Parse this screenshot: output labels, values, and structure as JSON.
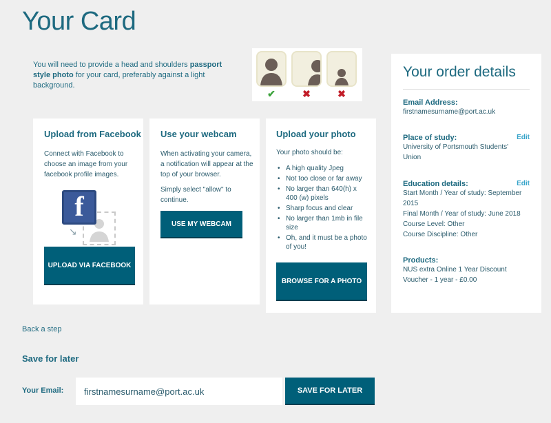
{
  "page": {
    "title": "Your Card"
  },
  "intro": {
    "text_before": "You will need to provide a head and shoulders ",
    "bold": "passport style photo",
    "text_after": " for your card, preferably against a light background."
  },
  "photo_examples": [
    {
      "result": "✔",
      "status": "good",
      "icon": "good-photo-example"
    },
    {
      "result": "✖",
      "status": "bad",
      "icon": "off-center-photo-example"
    },
    {
      "result": "✖",
      "status": "bad",
      "icon": "too-far-photo-example"
    }
  ],
  "facebook": {
    "title": "Upload from Facebook",
    "text": "Connect with Facebook to choose an image from your facebook profile images.",
    "logo_letter": "f",
    "button": "UPLOAD VIA FACEBOOK"
  },
  "webcam": {
    "title": "Use your webcam",
    "text1": "When activating your camera, a notification will appear at the top of your browser.",
    "text2": "Simply select \"allow\" to continue.",
    "button": "USE MY WEBCAM"
  },
  "upload": {
    "title": "Upload your photo",
    "intro": "Your photo should be:",
    "requirements": [
      "A high quality Jpeg",
      "Not too close or far away",
      "No larger than 640(h) x 400 (w) pixels",
      "Sharp focus and clear",
      "No larger than 1mb in file size",
      "Oh, and it must be a photo of you!"
    ],
    "button": "BROWSE FOR A PHOTO"
  },
  "order": {
    "title": "Your order details",
    "email_label": "Email Address:",
    "email_value": "firstnamesurname@port.ac.uk",
    "study_label": "Place of study:",
    "study_value": "University of Portsmouth Students' Union",
    "edit_label": "Edit",
    "education_label": "Education details:",
    "education_lines": [
      "Start Month / Year of study: September 2015",
      "Final Month / Year of study: June 2018",
      "Course Level: Other",
      "Course Discipline: Other"
    ],
    "products_label": "Products:",
    "products_value": "NUS extra Online 1 Year Discount Voucher - 1 year - £0.00"
  },
  "back_link": "Back a step",
  "save": {
    "title": "Save for later",
    "email_label": "Your Email:",
    "email_value": "firstnamesurname@port.ac.uk",
    "button": "SAVE FOR LATER"
  },
  "colors": {
    "accent": "#005f79",
    "heading": "#1e6a80",
    "ok": "#3aa23a",
    "bad": "#c21c27",
    "facebook": "#3b5a9a"
  }
}
